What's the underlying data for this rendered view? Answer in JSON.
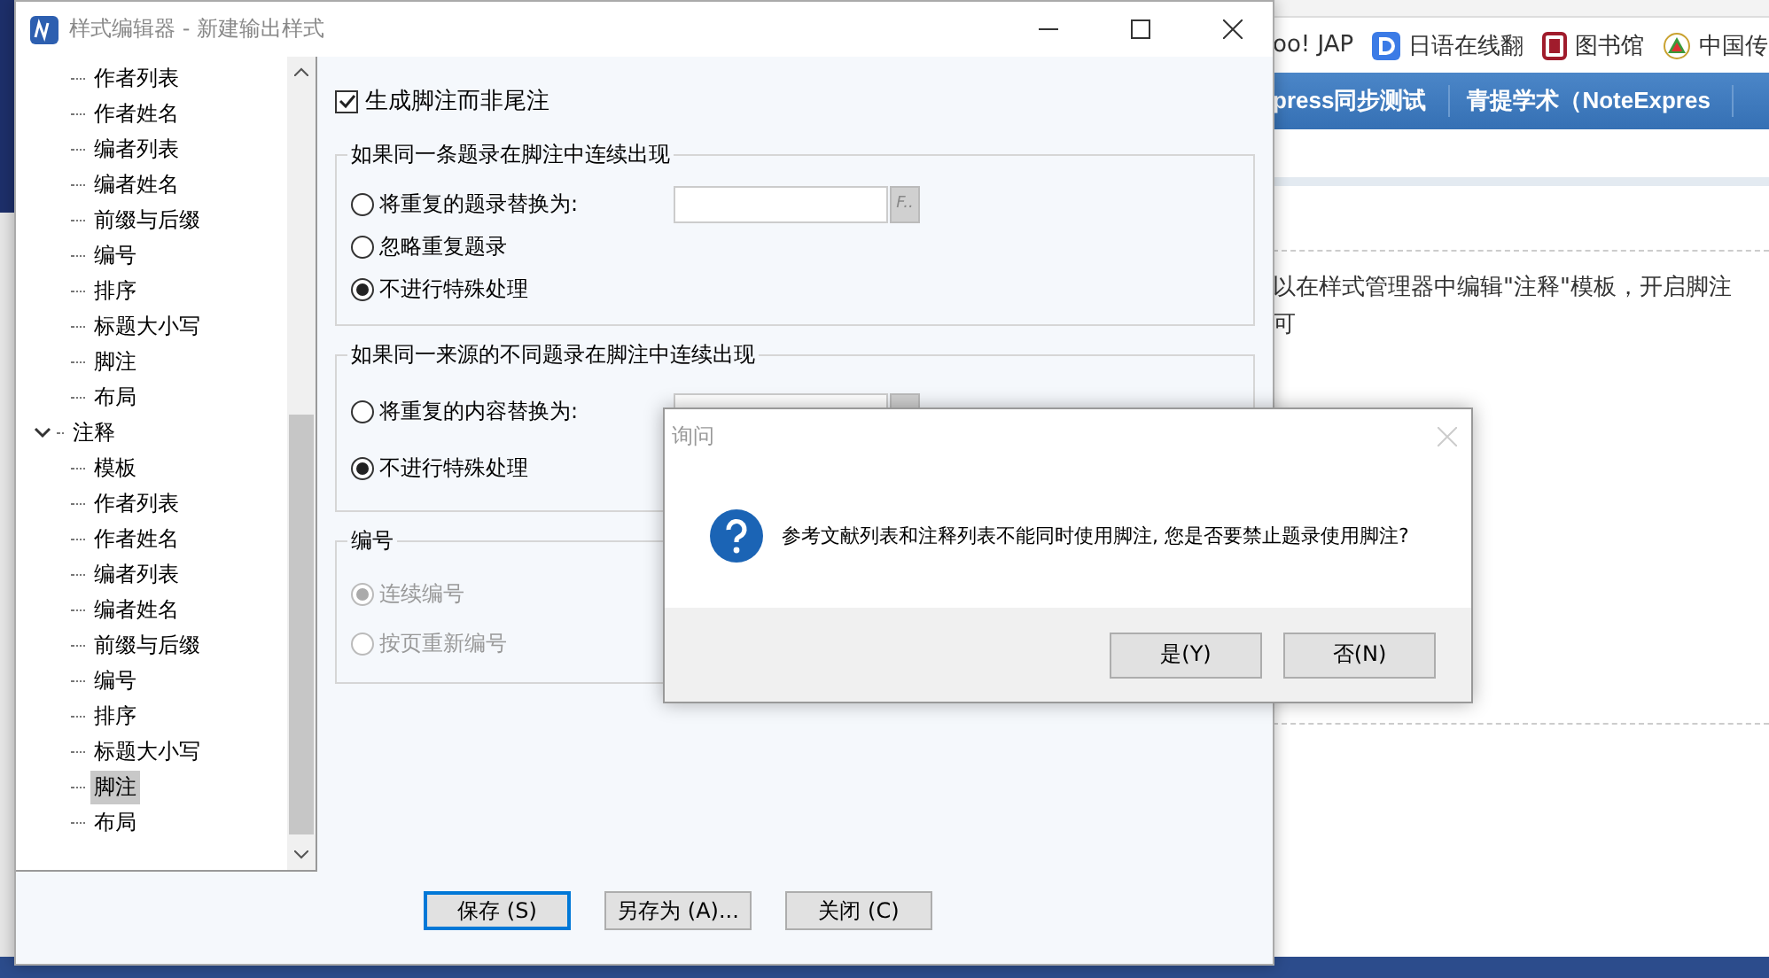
{
  "browser": {
    "bookmarks": [
      {
        "label": "oo! JAP"
      },
      {
        "label": "日语在线翻"
      },
      {
        "label": "图书馆"
      },
      {
        "label": "中国传"
      }
    ],
    "nav": [
      "press同步测试",
      "青提学术（NoteExpres"
    ],
    "body_lines": [
      "以在样式管理器中编辑\"注释\"模板，开启脚注",
      "可"
    ]
  },
  "editor": {
    "title": "样式编辑器 - 新建输出样式",
    "tree": [
      {
        "children": [
          {
            "label": "作者列表",
            "selected": false
          },
          {
            "label": "作者姓名",
            "selected": false
          },
          {
            "label": "编者列表",
            "selected": false
          },
          {
            "label": "编者姓名",
            "selected": false
          },
          {
            "label": "前缀与后缀",
            "selected": false
          },
          {
            "label": "编号",
            "selected": false
          },
          {
            "label": "排序",
            "selected": false
          },
          {
            "label": "标题大小写",
            "selected": false
          },
          {
            "label": "脚注",
            "selected": false
          },
          {
            "label": "布局",
            "selected": false
          }
        ]
      },
      {
        "label": "注释",
        "expanded": true,
        "children": [
          {
            "label": "模板",
            "selected": false
          },
          {
            "label": "作者列表",
            "selected": false
          },
          {
            "label": "作者姓名",
            "selected": false
          },
          {
            "label": "编者列表",
            "selected": false
          },
          {
            "label": "编者姓名",
            "selected": false
          },
          {
            "label": "前缀与后缀",
            "selected": false
          },
          {
            "label": "编号",
            "selected": false
          },
          {
            "label": "排序",
            "selected": false
          },
          {
            "label": "标题大小写",
            "selected": false
          },
          {
            "label": "脚注",
            "selected": true
          },
          {
            "label": "布局",
            "selected": false
          }
        ]
      }
    ],
    "footnote_checkbox": {
      "label": "生成脚注而非尾注",
      "checked": true
    },
    "groups": [
      {
        "title": "如果同一条题录在脚注中连续出现",
        "options": [
          {
            "kind": "field",
            "label": "将重复的题录替换为:",
            "selected": false,
            "disabled": false,
            "button": "F.."
          },
          {
            "kind": "plain",
            "label": "忽略重复题录",
            "selected": false,
            "disabled": false
          },
          {
            "kind": "plain",
            "label": "不进行特殊处理",
            "selected": true,
            "disabled": false
          }
        ]
      },
      {
        "title": "如果同一来源的不同题录在脚注中连续出现",
        "options": [
          {
            "kind": "field",
            "label": "将重复的内容替换为:",
            "selected": false,
            "disabled": false
          },
          {
            "kind": "plain",
            "label": "不进行特殊处理",
            "selected": true,
            "disabled": false
          }
        ]
      },
      {
        "title": "编号",
        "options": [
          {
            "kind": "plain",
            "label": "连续编号",
            "selected": true,
            "disabled": true
          },
          {
            "kind": "plain",
            "label": "按页重新编号",
            "selected": false,
            "disabled": true
          }
        ]
      }
    ],
    "buttons": [
      {
        "label": "保存 (S)",
        "default": true
      },
      {
        "label": "另存为 (A)...",
        "default": false
      },
      {
        "label": "关闭 (C)",
        "default": false
      }
    ]
  },
  "dialog": {
    "title": "询问",
    "message": "参考文献列表和注释列表不能同时使用脚注, 您是否要禁止题录使用脚注?",
    "buttons": [
      "是(Y)",
      "否(N)"
    ]
  }
}
